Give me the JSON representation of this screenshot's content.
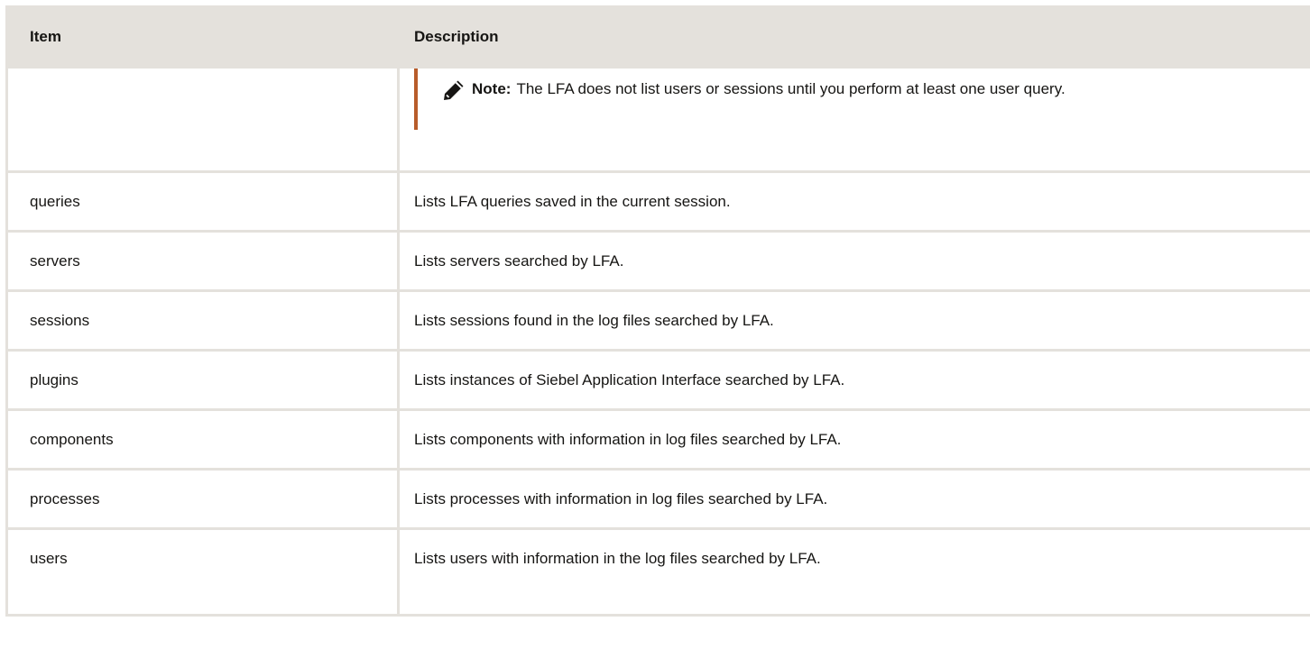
{
  "table": {
    "headers": [
      "Item",
      "Description"
    ],
    "note": {
      "label": "Note:",
      "text": "The LFA does not list users or sessions until you perform at least one user query.",
      "icon": "pencil-icon"
    },
    "rows": [
      {
        "item": "queries",
        "description": "Lists LFA queries saved in the current session."
      },
      {
        "item": "servers",
        "description": "Lists servers searched by LFA."
      },
      {
        "item": "sessions",
        "description": "Lists sessions found in the log files searched by LFA."
      },
      {
        "item": "plugins",
        "description": "Lists instances of Siebel Application Interface searched by LFA."
      },
      {
        "item": "components",
        "description": "Lists components with information in log files searched by LFA."
      },
      {
        "item": "processes",
        "description": "Lists processes with information in log files searched by LFA."
      },
      {
        "item": "users",
        "description": "Lists users with information in the log files searched by LFA."
      }
    ]
  },
  "colors": {
    "header_bg": "#e4e1dc",
    "border": "#e4e1dc",
    "note_accent": "#b85c2a"
  }
}
